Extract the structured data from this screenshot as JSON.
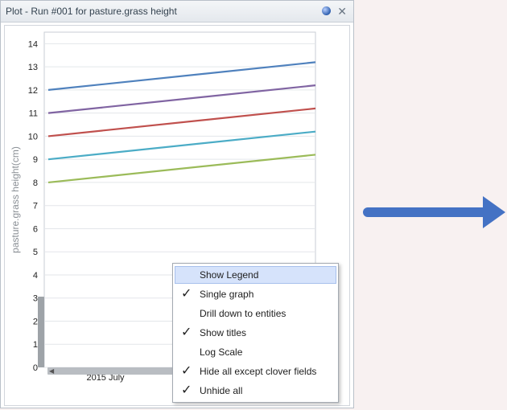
{
  "window": {
    "title": "Plot - Run #001 for pasture.grass height",
    "pin_icon": "pin-icon",
    "close_glyph": "✕"
  },
  "chart_data": {
    "type": "line",
    "ylabel": "pasture.grass height(cm)",
    "xlabel": "",
    "x_tick_labels": [
      "2015 July"
    ],
    "y_ticks": [
      0,
      1,
      2,
      3,
      4,
      5,
      6,
      7,
      8,
      9,
      10,
      11,
      12,
      13,
      14
    ],
    "ylim": [
      0,
      14.5
    ],
    "grid": true,
    "x": [
      "start",
      "end"
    ],
    "series": [
      {
        "color": "#4f81bd",
        "values": [
          12.0,
          13.2
        ]
      },
      {
        "color": "#8064a2",
        "values": [
          11.0,
          12.2
        ]
      },
      {
        "color": "#c0504d",
        "values": [
          10.0,
          11.2
        ]
      },
      {
        "color": "#4bacc6",
        "values": [
          9.0,
          10.2
        ]
      },
      {
        "color": "#9bbb59",
        "values": [
          8.0,
          9.2
        ]
      }
    ]
  },
  "context_menu": {
    "items": [
      {
        "label": "Show Legend",
        "checked": false,
        "highlighted": true
      },
      {
        "label": "Single graph",
        "checked": true,
        "highlighted": false
      },
      {
        "label": "Drill down to entities",
        "checked": false,
        "highlighted": false
      },
      {
        "label": "Show titles",
        "checked": true,
        "highlighted": false
      },
      {
        "label": "Log Scale",
        "checked": false,
        "highlighted": false
      },
      {
        "label": "Hide all except clover fields",
        "checked": true,
        "highlighted": false
      },
      {
        "label": "Unhide all",
        "checked": true,
        "highlighted": false
      }
    ]
  },
  "arrow": {
    "color": "#4472c4"
  }
}
